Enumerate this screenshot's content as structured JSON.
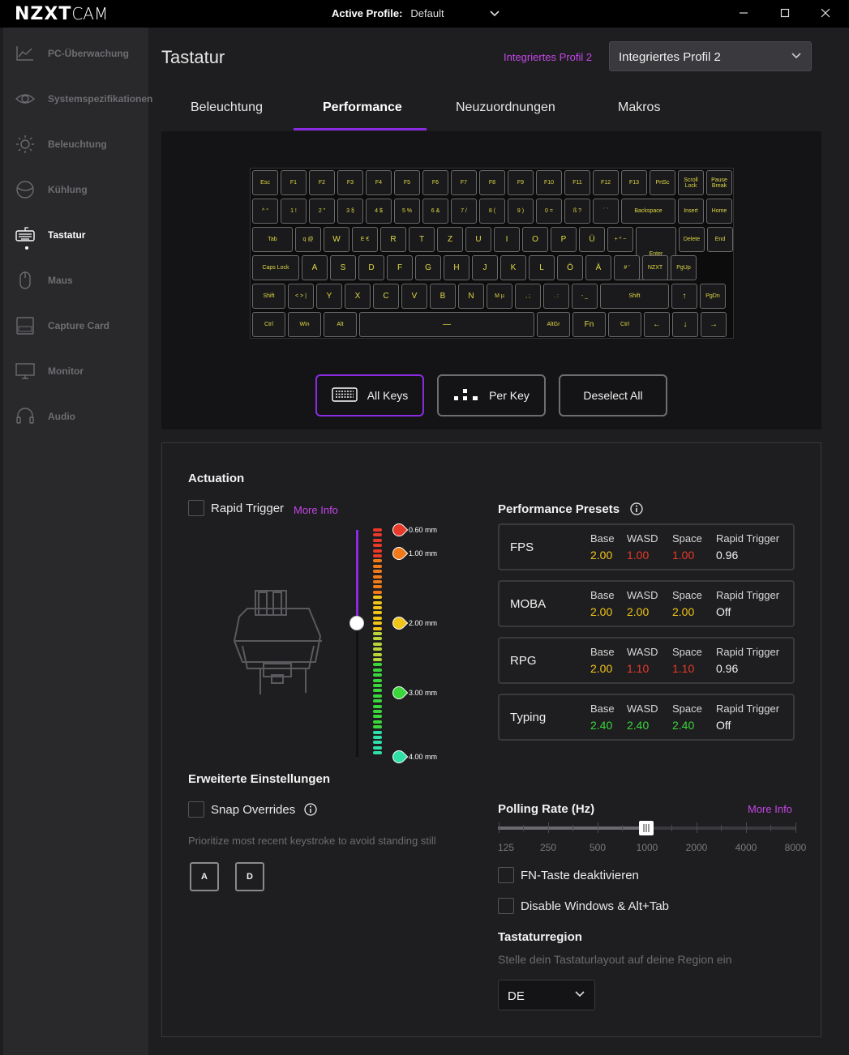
{
  "app": {
    "logo_bold": "NZXT",
    "logo_light": "CAM",
    "active_profile_label": "Active Profile:",
    "active_profile_value": "Default"
  },
  "sidebar": {
    "items": [
      {
        "label": "PC-Überwachung",
        "icon": "chart-line-icon"
      },
      {
        "label": "Systemspezifikationen",
        "icon": "eye-icon"
      },
      {
        "label": "Beleuchtung",
        "icon": "sun-icon"
      },
      {
        "label": "Kühlung",
        "icon": "fan-icon"
      },
      {
        "label": "Tastatur",
        "icon": "keyboard-icon",
        "active": true
      },
      {
        "label": "Maus",
        "icon": "mouse-icon"
      },
      {
        "label": "Capture Card",
        "icon": "capture-card-icon"
      },
      {
        "label": "Monitor",
        "icon": "monitor-icon"
      },
      {
        "label": "Audio",
        "icon": "headset-icon"
      }
    ]
  },
  "header": {
    "title": "Tastatur",
    "profile_tag": "Integriertes Profil 2",
    "profile_select": "Integriertes Profil 2"
  },
  "tabs": [
    {
      "label": "Beleuchtung"
    },
    {
      "label": "Performance",
      "active": true
    },
    {
      "label": "Neuzuordnungen"
    },
    {
      "label": "Makros"
    }
  ],
  "keyboard": {
    "rows": [
      [
        "Esc",
        "F1",
        "F2",
        "F3",
        "F4",
        "F5",
        "F6",
        "F7",
        "F8",
        "F9",
        "F10",
        "F11",
        "F12",
        "F13",
        "PrtSc",
        "Scroll Lock",
        "Pause Break"
      ],
      [
        "^ °",
        "1 !",
        "2 \"",
        "3 §",
        "4 $",
        "5 %",
        "6 &",
        "7 /",
        "8 (",
        "9 )",
        "0 =",
        "ß ?",
        "´ `",
        "Backspace",
        "Insert",
        "Home"
      ],
      [
        "Tab",
        "q @",
        "W",
        "E €",
        "R",
        "T",
        "Z",
        "U",
        "I",
        "O",
        "P",
        "Ü",
        "+ * ~",
        "Enter",
        "Delete",
        "End"
      ],
      [
        "Caps Lock",
        "A",
        "S",
        "D",
        "F",
        "G",
        "H",
        "J",
        "K",
        "L",
        "Ö",
        "Ä",
        "# '",
        "NZXT",
        "PgUp"
      ],
      [
        "Shift",
        "< > |",
        "Y",
        "X",
        "C",
        "V",
        "B",
        "N",
        "M µ",
        ", ;",
        ". :",
        "- _",
        "Shift",
        "↑",
        "PgDn"
      ],
      [
        "Ctrl",
        "Win",
        "Alt",
        "—",
        "AltGr",
        "Fn",
        "Ctrl",
        "←",
        "↓",
        "→"
      ]
    ]
  },
  "mode_buttons": {
    "all_keys": "All Keys",
    "per_key": "Per Key",
    "deselect_all": "Deselect All"
  },
  "actuation": {
    "heading": "Actuation",
    "rapid_trigger_label": "Rapid Trigger",
    "more_info": "More Info",
    "level_mm": 2.0,
    "marks": [
      "0.60 mm",
      "1.00 mm",
      "2.00 mm",
      "3.00 mm",
      "4.00 mm"
    ]
  },
  "presets": {
    "heading": "Performance Presets",
    "columns": [
      "Base",
      "WASD",
      "Space",
      "Rapid Trigger"
    ],
    "items": [
      {
        "name": "FPS",
        "base": "2.00",
        "wasd": "1.00",
        "space": "1.00",
        "rapid": "0.96"
      },
      {
        "name": "MOBA",
        "base": "2.00",
        "wasd": "2.00",
        "space": "2.00",
        "rapid": "Off"
      },
      {
        "name": "RPG",
        "base": "2.00",
        "wasd": "1.10",
        "space": "1.10",
        "rapid": "0.96"
      },
      {
        "name": "Typing",
        "base": "2.40",
        "wasd": "2.40",
        "space": "2.40",
        "rapid": "Off"
      }
    ]
  },
  "advanced": {
    "heading": "Erweiterte Einstellungen",
    "snap_label": "Snap Overrides",
    "snap_desc": "Prioritize most recent keystroke to avoid standing still",
    "key_a": "A",
    "key_d": "D"
  },
  "polling": {
    "heading": "Polling Rate (Hz)",
    "more_info": "More Info",
    "values": [
      "125",
      "250",
      "500",
      "1000",
      "2000",
      "4000",
      "8000"
    ],
    "selected": "1000",
    "fn_label": "FN-Taste deaktivieren",
    "win_label": "Disable Windows & Alt+Tab"
  },
  "region": {
    "heading": "Tastaturregion",
    "desc": "Stelle dein Tastaturlayout auf deine Region ein",
    "value": "DE"
  },
  "colors": {
    "accent": "#8a2be2",
    "link": "#c546e8",
    "key_text": "#e0d844",
    "yellow": "#f0c419",
    "red": "#e8392a",
    "green": "#3bd63b"
  }
}
